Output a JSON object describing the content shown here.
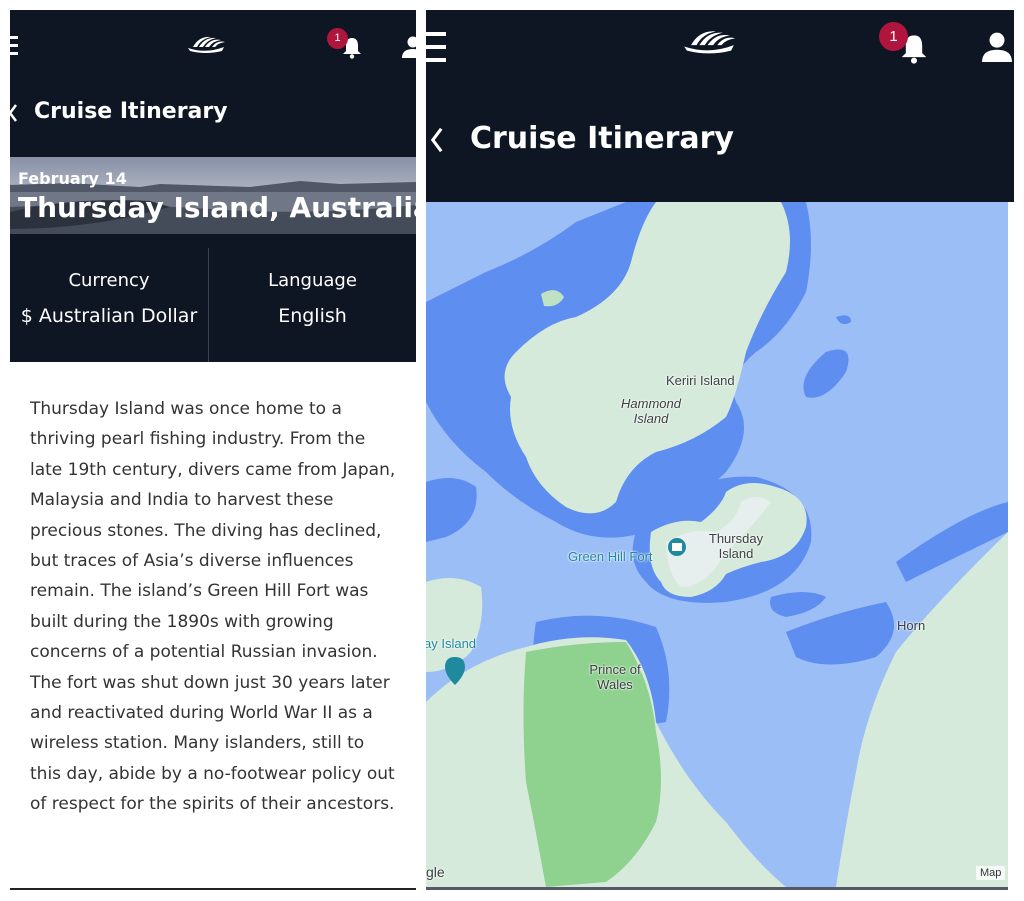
{
  "screens": [
    {
      "header": {
        "title": "Cruise Itinerary",
        "notification_count": "1"
      },
      "port": {
        "date": "February 14",
        "name": "Thursday Island, Australia"
      },
      "info": {
        "currency_label": "Currency",
        "currency_value": "$ Australian Dollar",
        "language_label": "Language",
        "language_value": "English"
      },
      "description": "Thursday Island was once home to a thriving pearl fishing industry. From the late 19th century, divers came from Japan, Malaysia and India to harvest these precious stones. The diving has declined, but traces of Asia’s diverse influences remain. The island’s Green Hill Fort was built during the 1890s with growing concerns of a potential Russian invasion. The fort was shut down just 30 years later and reactivated during World War II as a wireless station. Many islanders, still to this day, abide by a no-footwear policy out of respect for the spirits of their ancestors."
    },
    {
      "header": {
        "title": "Cruise Itinerary",
        "notification_count": "1"
      },
      "map": {
        "labels": {
          "keriri": "Keriri Island",
          "hammond": "Hammond Island",
          "green_hill_fort": "Green Hill Fort",
          "thursday": "Thursday Island",
          "horn": "Horn",
          "prince_of_wales": "Prince of Wales",
          "edge_island": "ay Island",
          "google": "gle",
          "map_tag": "Map"
        },
        "colors": {
          "water": "#9cbef7",
          "shallow": "#5d8ef0",
          "land": "#d6eadc",
          "park": "#8fd18f"
        }
      }
    }
  ]
}
